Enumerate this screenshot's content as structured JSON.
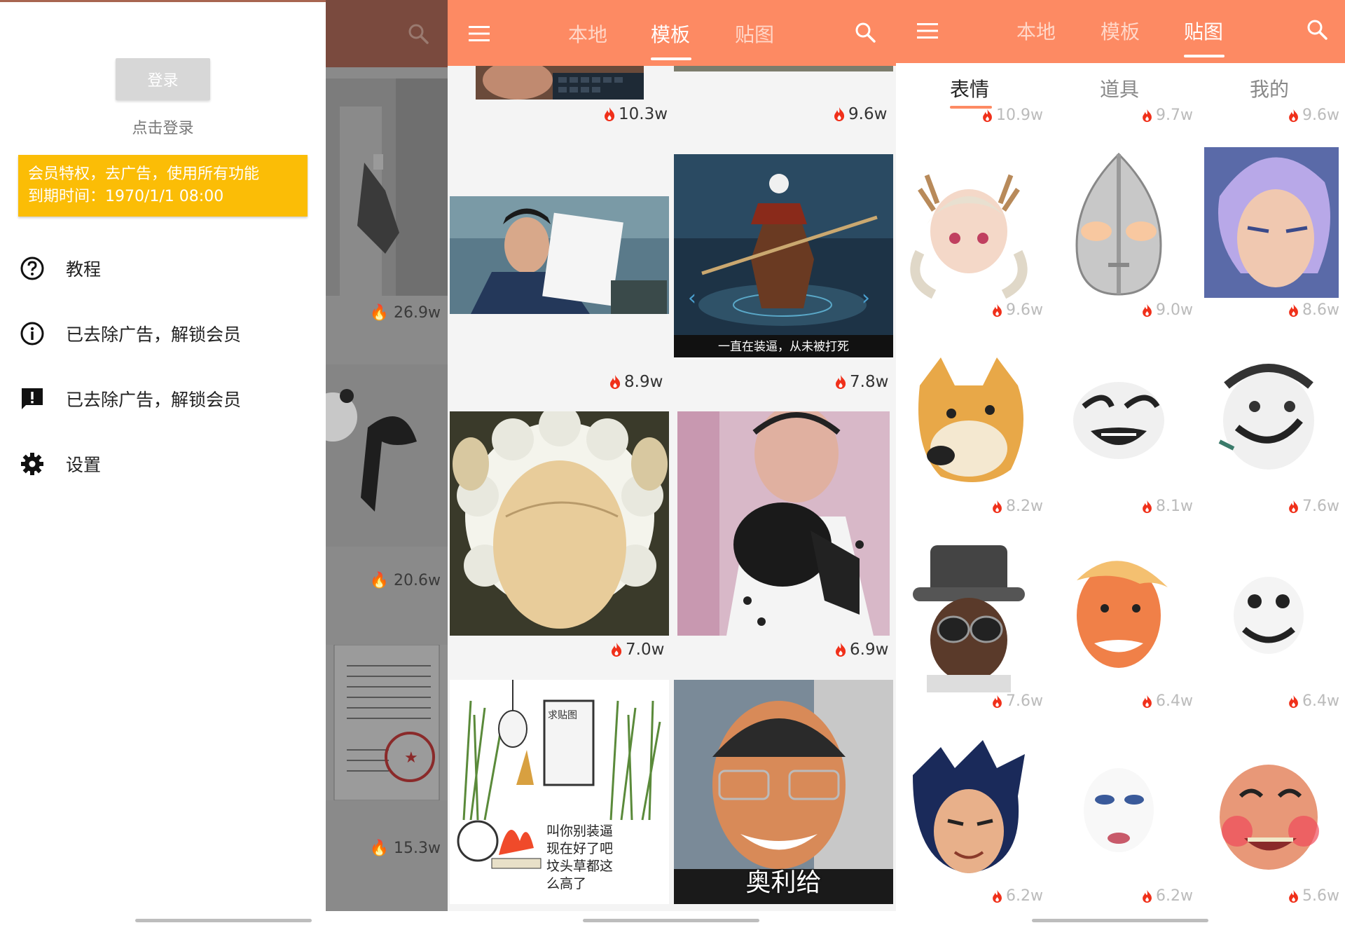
{
  "screen1": {
    "login_button": "登录",
    "login_hint": "点击登录",
    "vip_line1": "会员特权，去广告，使用所有功能",
    "vip_line2": "到期时间：1970/1/1 08:00",
    "menu": [
      {
        "label": "教程",
        "icon": "help-circle-icon"
      },
      {
        "label": "已去除广告，解锁会员",
        "icon": "info-icon"
      },
      {
        "label": "已去除广告，解锁会员",
        "icon": "feedback-icon"
      },
      {
        "label": "设置",
        "icon": "gear-icon"
      }
    ],
    "background_counts": [
      "26.9w",
      "20.6w",
      "15.3w"
    ]
  },
  "screen2": {
    "tabs": [
      "本地",
      "模板",
      "贴图"
    ],
    "active_tab": "模板",
    "counts": [
      "10.3w",
      "9.6w",
      "8.9w",
      "7.8w",
      "7.0w",
      "6.9w"
    ],
    "captions": {
      "hero": "一直在装逼，从未被打死",
      "comic": "叫你别装逼\n现在好了吧\n坟头草都这\n么高了",
      "tombstone": "求贴图",
      "face": "奥利给"
    }
  },
  "screen3": {
    "tabs": [
      "本地",
      "模板",
      "贴图"
    ],
    "active_tab": "贴图",
    "subtabs": [
      "表情",
      "道具",
      "我的"
    ],
    "active_subtab": "表情",
    "top_counts": [
      "10.9w",
      "9.7w",
      "9.6w"
    ],
    "counts": [
      "9.6w",
      "9.0w",
      "8.6w",
      "8.2w",
      "8.1w",
      "7.6w",
      "7.6w",
      "6.4w",
      "6.4w",
      "6.2w",
      "6.2w",
      "5.6w"
    ]
  },
  "colors": {
    "accent": "#fd8a63",
    "vip": "#fbbd06",
    "fire": "#f0301a"
  }
}
